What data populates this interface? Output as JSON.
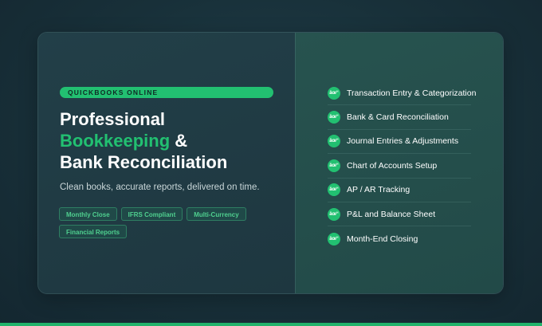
{
  "hero": {
    "eyebrow": "QUICKBOOKS ONLINE",
    "headline_line1": "Professional",
    "headline_accent": "Bookkeeping",
    "headline_amp": " &",
    "headline_line3": "Bank Reconciliation",
    "subtitle": "Clean books, accurate reports, delivered on time.",
    "tags": [
      "Monthly Close",
      "IFRS Compliant",
      "Multi-Currency",
      "Financial Reports"
    ]
  },
  "features": {
    "check_glyph": "âœ“",
    "items": [
      "Transaction Entry & Categorization",
      "Bank & Card Reconciliation",
      "Journal Entries & Adjustments",
      "Chart of Accounts Setup",
      "AP / AR Tracking",
      "P&L and Balance Sheet",
      "Month-End Closing"
    ]
  },
  "colors": {
    "accent": "#22c071",
    "background": "#183039",
    "panel_left": "#223f48",
    "panel_right": "#27534f"
  }
}
